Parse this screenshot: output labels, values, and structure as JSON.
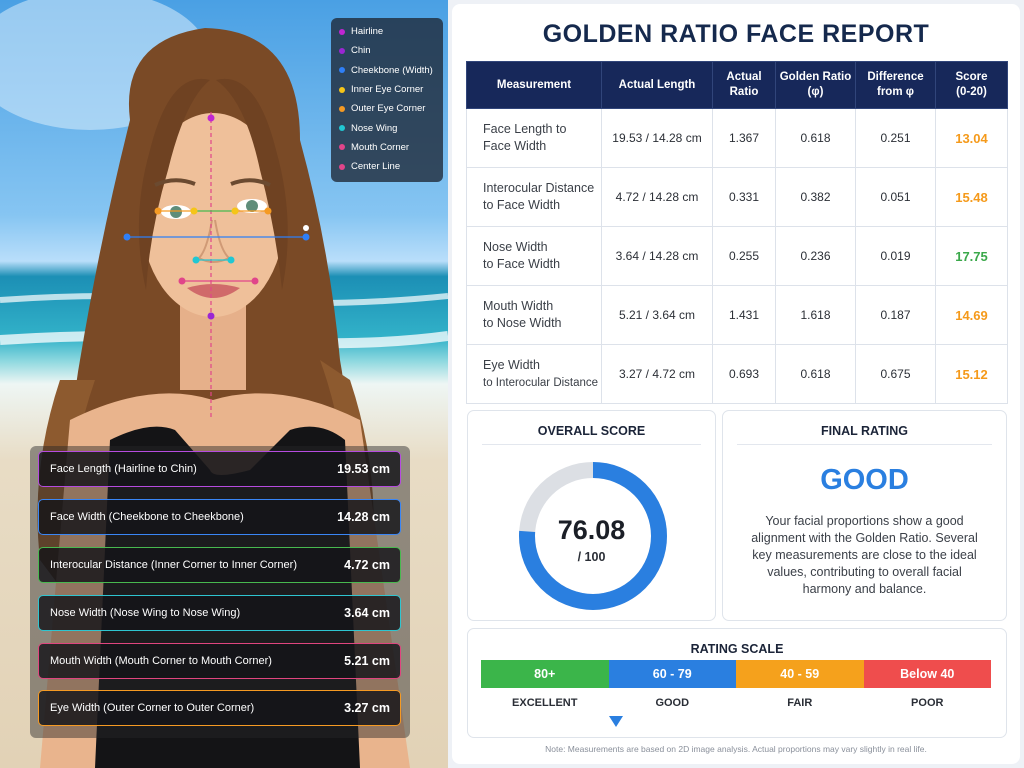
{
  "legend": [
    {
      "label": "Hairline",
      "color": "#c026d3"
    },
    {
      "label": "Chin",
      "color": "#9b26d3"
    },
    {
      "label": "Cheekbone (Width)",
      "color": "#2f7ff7"
    },
    {
      "label": "Inner Eye Corner",
      "color": "#f5c518"
    },
    {
      "label": "Outer Eye Corner",
      "color": "#f59a23"
    },
    {
      "label": "Nose Wing",
      "color": "#21c7d3"
    },
    {
      "label": "Mouth Corner",
      "color": "#e0458a"
    },
    {
      "label": "Center Line",
      "color": "#e0458a"
    }
  ],
  "measurements": [
    {
      "label": "Face Length (Hairline to Chin)",
      "value": "19.53 cm",
      "color": "#b64be0"
    },
    {
      "label": "Face Width (Cheekbone to Cheekbone)",
      "value": "14.28 cm",
      "color": "#3a86f5"
    },
    {
      "label": "Interocular Distance (Inner Corner to Inner Corner)",
      "value": "4.72 cm",
      "color": "#48b94f"
    },
    {
      "label": "Nose Width (Nose Wing to Nose Wing)",
      "value": "3.64 cm",
      "color": "#2ec5d0"
    },
    {
      "label": "Mouth Width (Mouth Corner to Mouth Corner)",
      "value": "5.21 cm",
      "color": "#e0457f"
    },
    {
      "label": "Eye Width (Outer Corner to Outer Corner)",
      "value": "3.27 cm",
      "color": "#f59a23"
    }
  ],
  "report": {
    "title": "GOLDEN RATIO FACE REPORT",
    "headers": [
      "Measurement",
      "Actual Length",
      "Actual\nRatio",
      "Golden Ratio\n(φ)",
      "Difference\nfrom φ",
      "Score\n(0-20)"
    ],
    "rows": [
      {
        "name1": "Face Length to",
        "name2": "Face Width",
        "length": "19.53 / 14.28 cm",
        "ratio": "1.367",
        "golden": "0.618",
        "diff": "0.251",
        "score": "13.04",
        "score_color": "#f59a1b"
      },
      {
        "name1": "Interocular Distance",
        "name2": "to Face Width",
        "length": "4.72 / 14.28 cm",
        "ratio": "0.331",
        "golden": "0.382",
        "diff": "0.051",
        "score": "15.48",
        "score_color": "#f59a1b"
      },
      {
        "name1": "Nose Width",
        "name2": "to Face Width",
        "length": "3.64 / 14.28 cm",
        "ratio": "0.255",
        "golden": "0.236",
        "diff": "0.019",
        "score": "17.75",
        "score_color": "#3aa84a"
      },
      {
        "name1": "Mouth Width",
        "name2": "to Nose Width",
        "length": "5.21 / 3.64 cm",
        "ratio": "1.431",
        "golden": "1.618",
        "diff": "0.187",
        "score": "14.69",
        "score_color": "#f59a1b"
      },
      {
        "name1": "Eye Width",
        "name2": "to Interocular Distance",
        "length": "3.27 / 4.72 cm",
        "ratio": "0.693",
        "golden": "0.618",
        "diff": "0.675",
        "score": "15.12",
        "score_color": "#f59a1b"
      }
    ],
    "overall": {
      "title": "OVERALL SCORE",
      "score": "76.08",
      "sub": "/ 100",
      "fraction": 0.7608,
      "ring_color": "#2a7fe0",
      "track_color": "#dcdfe4"
    },
    "final": {
      "title": "FINAL RATING",
      "rating": "GOOD",
      "description": "Your facial proportions show a good alignment with the Golden Ratio. Several key measurements are close to the ideal values, contributing to overall facial harmony and balance."
    },
    "scale": {
      "title": "RATING SCALE",
      "segments": [
        {
          "range": "80+",
          "label": "EXCELLENT",
          "color": "#3bb54a"
        },
        {
          "range": "60 - 79",
          "label": "GOOD",
          "color": "#2a7fe0"
        },
        {
          "range": "40 - 59",
          "label": "FAIR",
          "color": "#f5a11c"
        },
        {
          "range": "Below 40",
          "label": "POOR",
          "color": "#ef4d4d"
        }
      ],
      "current_index": 1
    },
    "note": "Note: Measurements are based on 2D image analysis. Actual proportions may vary slightly in real life."
  }
}
